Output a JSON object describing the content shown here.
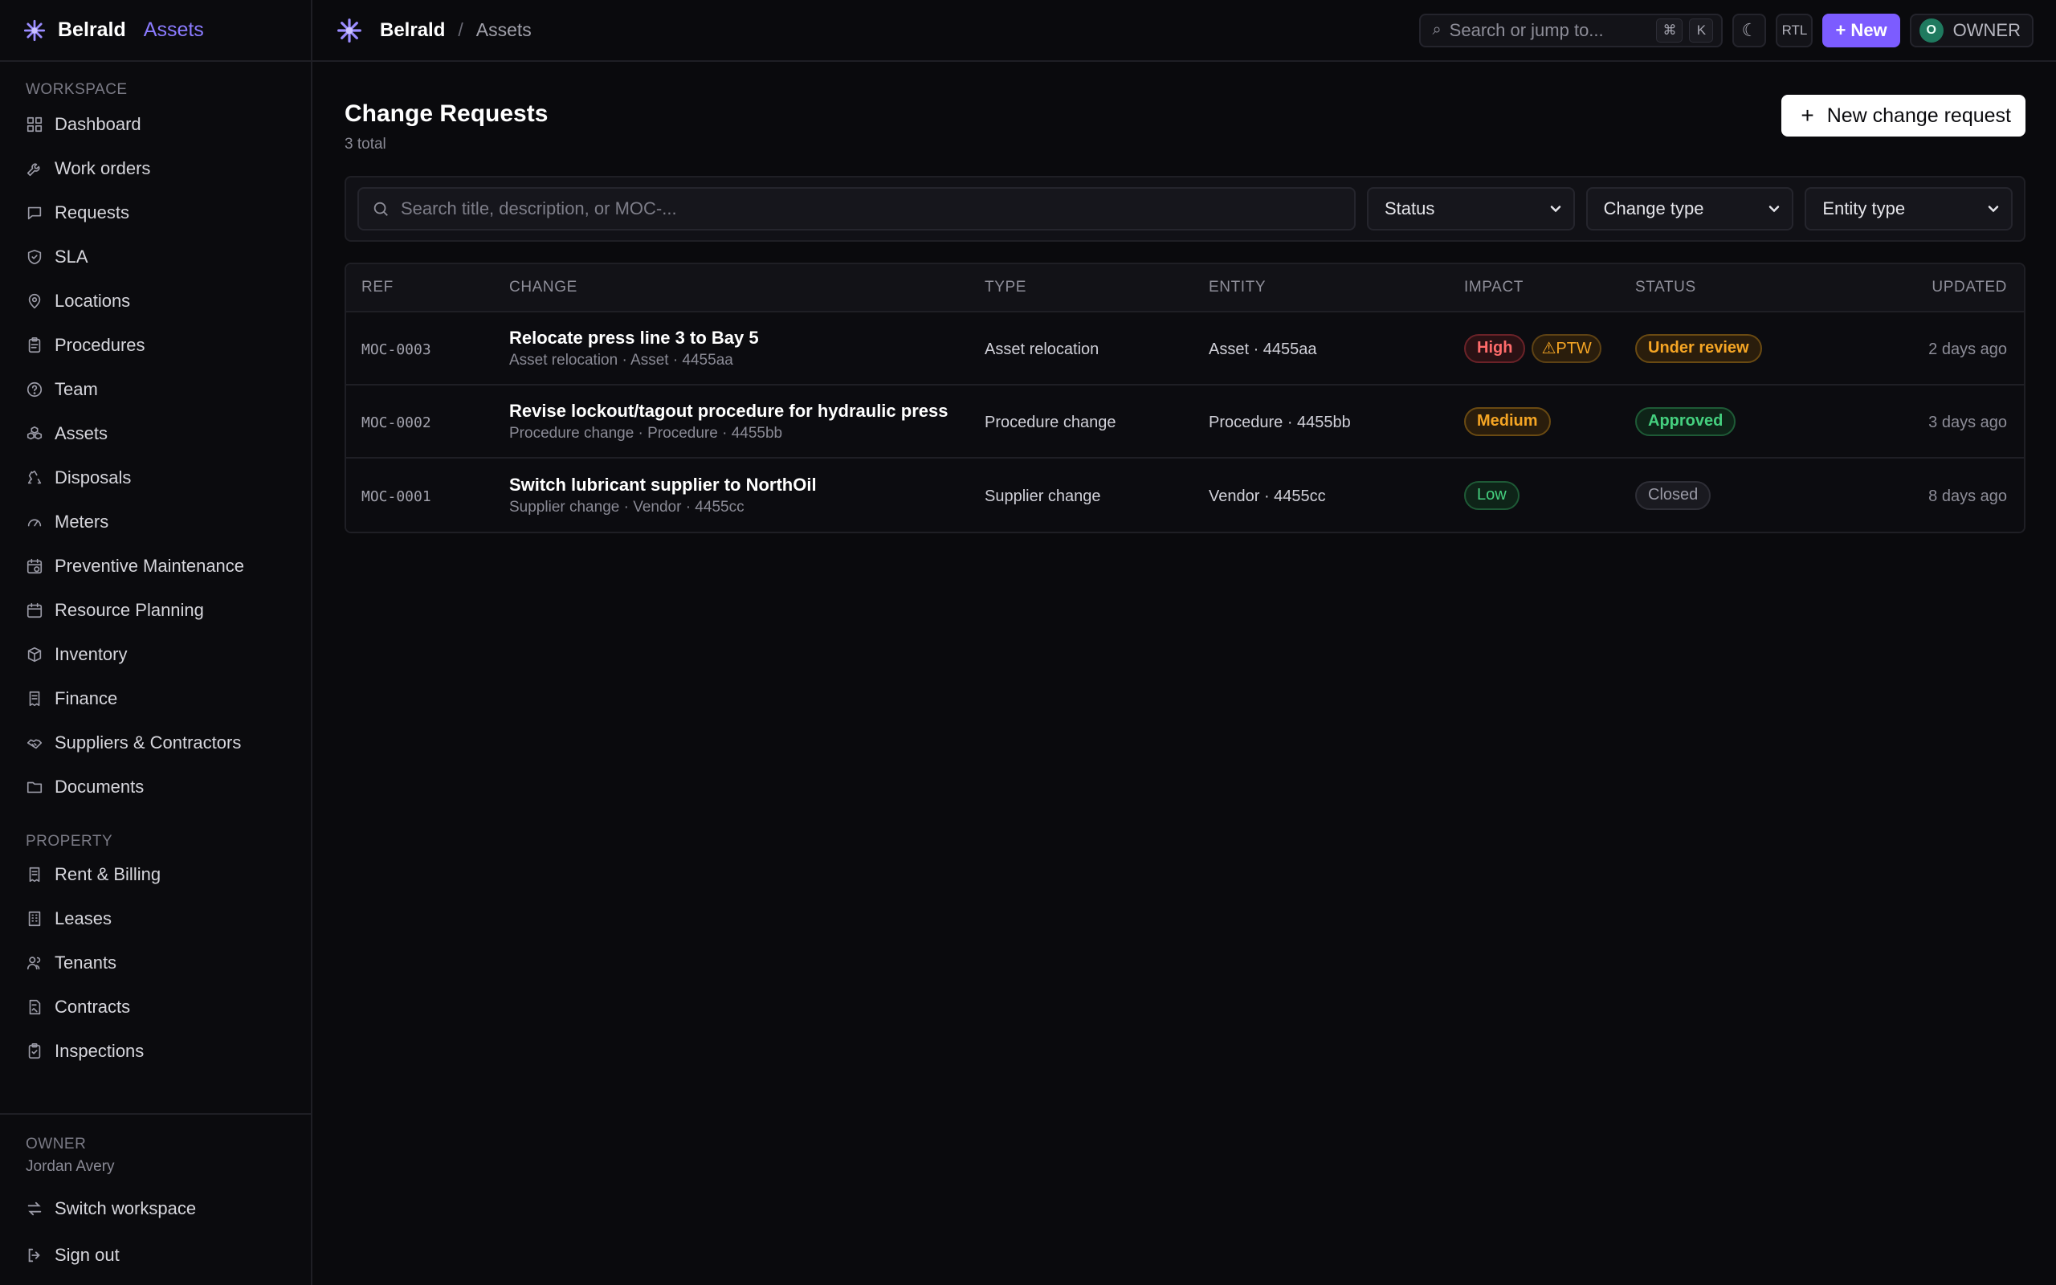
{
  "brand": {
    "name": "Belrald",
    "accent": "Assets"
  },
  "sidebar": {
    "workspace_label": "WORKSPACE",
    "workspace_items": [
      {
        "label": "Dashboard",
        "icon": "grid-icon"
      },
      {
        "label": "Work orders",
        "icon": "wrench-icon"
      },
      {
        "label": "Requests",
        "icon": "chat-icon"
      },
      {
        "label": "SLA",
        "icon": "shield-icon"
      },
      {
        "label": "Locations",
        "icon": "pin-icon"
      },
      {
        "label": "Procedures",
        "icon": "clipboard-icon"
      },
      {
        "label": "Team",
        "icon": "help-circle-icon"
      },
      {
        "label": "Assets",
        "icon": "boxes-icon"
      },
      {
        "label": "Disposals",
        "icon": "recycle-icon"
      },
      {
        "label": "Meters",
        "icon": "gauge-icon"
      },
      {
        "label": "Preventive Maintenance",
        "icon": "calendar-clock-icon"
      },
      {
        "label": "Resource Planning",
        "icon": "calendar-icon"
      },
      {
        "label": "Inventory",
        "icon": "package-icon"
      },
      {
        "label": "Finance",
        "icon": "receipt-icon"
      },
      {
        "label": "Suppliers & Contractors",
        "icon": "handshake-icon"
      },
      {
        "label": "Documents",
        "icon": "folder-icon"
      }
    ],
    "property_label": "PROPERTY",
    "property_items": [
      {
        "label": "Rent & Billing",
        "icon": "receipt-icon"
      },
      {
        "label": "Leases",
        "icon": "building-icon"
      },
      {
        "label": "Tenants",
        "icon": "users-icon"
      },
      {
        "label": "Contracts",
        "icon": "contract-icon"
      },
      {
        "label": "Inspections",
        "icon": "clipboard-check-icon"
      }
    ],
    "footer": {
      "role": "OWNER",
      "name": "Jordan Avery",
      "switch_label": "Switch workspace",
      "signout_label": "Sign out"
    }
  },
  "topbar": {
    "breadcrumb_root": "Belrald",
    "breadcrumb_sep": "/",
    "breadcrumb_current": "Assets",
    "search_placeholder": "Search or jump to...",
    "kbd_cmd": "⌘",
    "kbd_k": "K",
    "rtl_label": "RTL",
    "new_label": "+ New",
    "avatar_initial": "O",
    "owner_label": "OWNER"
  },
  "page": {
    "title": "Change Requests",
    "subtitle": "3 total",
    "create_button": "New change request"
  },
  "filters": {
    "search_placeholder": "Search title, description, or MOC-...",
    "status": "Status",
    "change_type": "Change type",
    "entity_type": "Entity type"
  },
  "table": {
    "headers": {
      "ref": "REF",
      "change": "CHANGE",
      "type": "TYPE",
      "entity": "ENTITY",
      "impact": "IMPACT",
      "status": "STATUS",
      "updated": "UPDATED"
    },
    "rows": [
      {
        "ref": "MOC-0003",
        "title": "Relocate press line 3 to Bay 5",
        "sub": "Asset relocation · Asset · 4455aa",
        "type": "Asset relocation",
        "entity": "Asset · 4455aa",
        "impact": "High",
        "ptw": "⚠PTW",
        "status": "Under review",
        "updated": "2 days ago"
      },
      {
        "ref": "MOC-0002",
        "title": "Revise lockout/tagout procedure for hydraulic press",
        "sub": "Procedure change · Procedure · 4455bb",
        "type": "Procedure change",
        "entity": "Procedure · 4455bb",
        "impact": "Medium",
        "status": "Approved",
        "updated": "3 days ago"
      },
      {
        "ref": "MOC-0001",
        "title": "Switch lubricant supplier to NorthOil",
        "sub": "Supplier change · Vendor · 4455cc",
        "type": "Supplier change",
        "entity": "Vendor · 4455cc",
        "impact": "Low",
        "status": "Closed",
        "updated": "8 days ago"
      }
    ]
  },
  "colors": {
    "accent": "#7c5cff",
    "brand_accent": "#8b7bff",
    "high": "#ff6b6b",
    "warning": "#f5a524",
    "success": "#45d07f"
  }
}
